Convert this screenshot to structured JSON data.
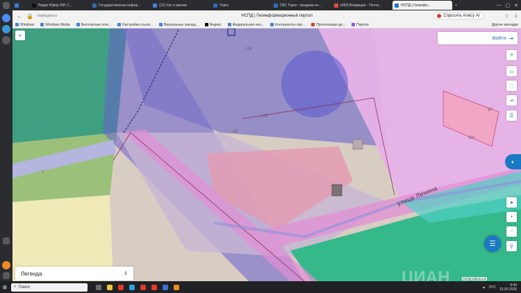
{
  "browser": {
    "tabs": [
      {
        "label": "",
        "color": "#3a7bd5",
        "active": false
      },
      {
        "label": "Радио Юмор FM: С...",
        "color": "#111111",
        "active": false
      },
      {
        "label": "Государственная инфор...",
        "color": "#2f6db5",
        "active": false
      },
      {
        "label": "(12) Чат и звонки",
        "color": "#4a7fd6",
        "active": false
      },
      {
        "label": "Торги",
        "color": "#2f6db5",
        "active": false
      },
      {
        "label": "ГИС Торги - продажа по...",
        "color": "#2f6db5",
        "active": false
      },
      {
        "label": "(493) Входящие - Почта...",
        "color": "#e84a3c",
        "active": false
      },
      {
        "label": "НСПД | Геоинфо...",
        "color": "#1b78c4",
        "active": true
      },
      {
        "label": "",
        "color": "#5a5b60",
        "active": false
      }
    ],
    "url": "nspd.gov.ru",
    "page_title": "НСПД | Геоинформационный портал",
    "ask_ai": "Спросить Алису AI",
    "bookmarks": [
      "Windows",
      "Windows Media",
      "Бесплатные почт...",
      "Настройка ссылк...",
      "Визуальные заклад...",
      "Яндекс",
      "Федеральная нал...",
      "Контрагенты про...",
      "Пролонгация до...",
      "Пароли"
    ],
    "other_bookmarks": "Другие закладки"
  },
  "map": {
    "login_label": "Войти",
    "street_label": "улица Ленина",
    "legend_label": "Легенда",
    "parcel_numbers": [
      "136",
      "175",
      "101",
      "43",
      "1",
      "97"
    ],
    "scale_text": "НСПД 2026 ● 1 м",
    "watermark": "ЦИАН"
  },
  "taskbar": {
    "search_placeholder": "Поиск",
    "lang": "РУС",
    "time": "9:49",
    "date": "15.05.2026"
  }
}
